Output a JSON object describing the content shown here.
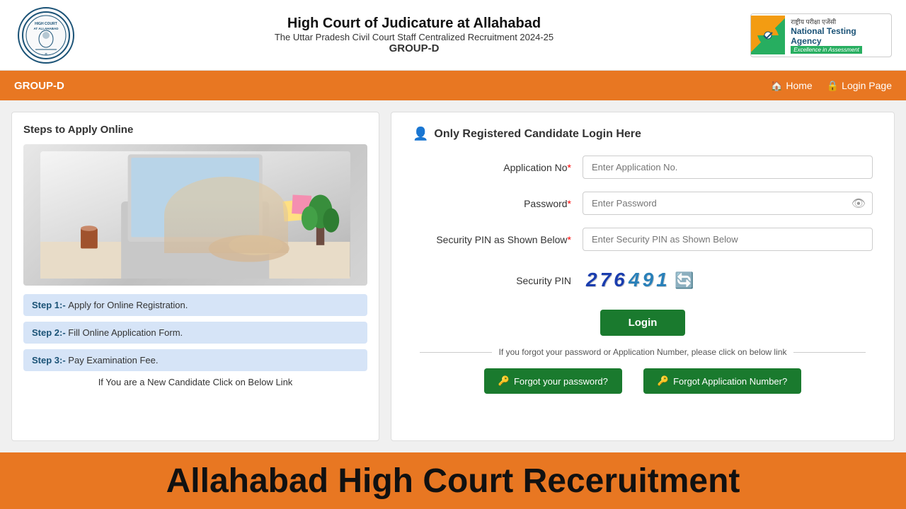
{
  "header": {
    "title": "High Court of Judicature at Allahabad",
    "subtitle": "The Uttar Pradesh Civil Court Staff Centralized Recruitment 2024-25",
    "group": "GROUP-D",
    "logo_text": "HIGH COURT AT ALLAHABAD",
    "nta_hindi": "राष्ट्रीय परीक्षा एजेंसी",
    "nta_english": "National Testing Agency",
    "nta_tagline": "Excellence in Assessment"
  },
  "navbar": {
    "brand": "GROUP-D",
    "home_label": "Home",
    "login_label": "Login Page"
  },
  "left_panel": {
    "title": "Steps to Apply Online",
    "step1": "Apply for Online Registration.",
    "step1_prefix": "Step 1:- ",
    "step2": "Fill Online Application Form.",
    "step2_prefix": "Step 2:- ",
    "step3": "Pay Examination Fee.",
    "step3_prefix": "Step 3:- ",
    "new_candidate_text": "If You are a New Candidate Click on Below Link"
  },
  "login_panel": {
    "heading": "Only Registered Candidate Login Here",
    "app_no_label": "Application No",
    "app_no_placeholder": "Enter Application No.",
    "password_label": "Password",
    "password_placeholder": "Enter Password",
    "security_pin_label": "Security PIN as Shown Below",
    "security_pin_placeholder": "Enter Security PIN as Shown Below",
    "captcha_label": "Security PIN",
    "captcha_value": "276491",
    "login_btn": "Login",
    "forgot_text": "If you forgot your password or Application Number, please click on below link",
    "forgot_password_btn": "Forgot your password?",
    "forgot_appno_btn": "Forgot Application Number?"
  },
  "bottom_banner": {
    "text": "Allahabad High Court Receruitment"
  }
}
